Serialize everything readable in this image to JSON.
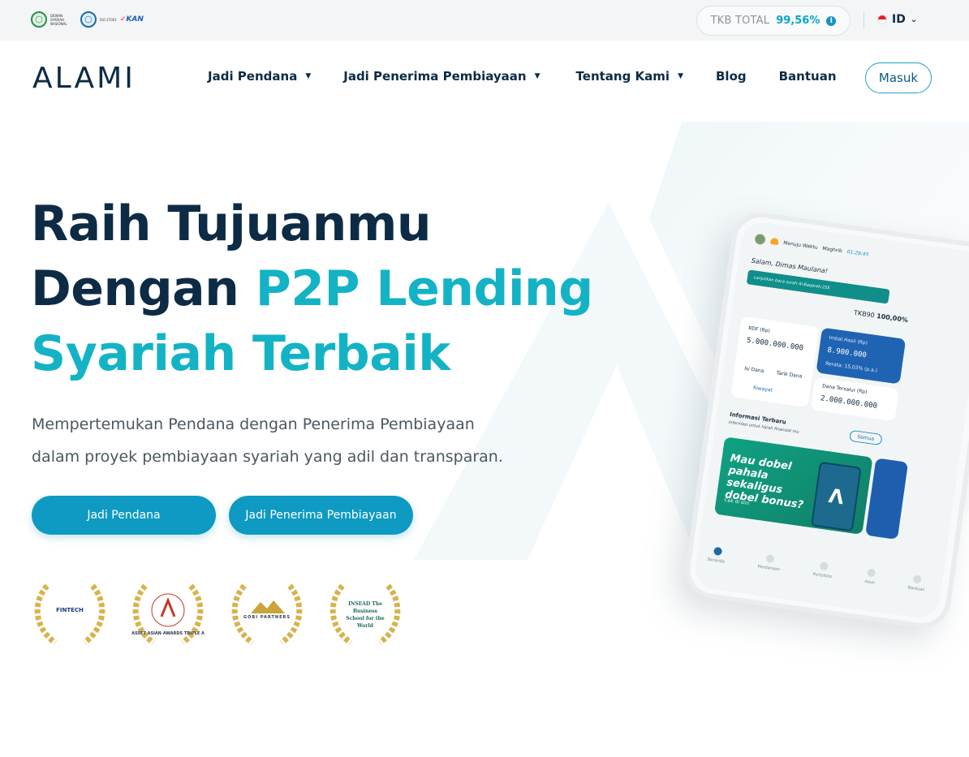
{
  "topbar": {
    "cert_mui_text": "DEWAN SYARIAH NASIONAL",
    "cert_kan_text": "ISO 27001",
    "kan_logo": "KAN",
    "tkb_label": "TKB TOTAL",
    "tkb_value": "99,56%",
    "language": "ID"
  },
  "nav": {
    "logo": "ALAMI",
    "items": [
      {
        "label": "Jadi Pendana",
        "has_dropdown": true
      },
      {
        "label": "Jadi Penerima Pembiayaan",
        "has_dropdown": true
      },
      {
        "label": "Tentang Kami",
        "has_dropdown": true
      },
      {
        "label": "Blog",
        "has_dropdown": false
      },
      {
        "label": "Bantuan",
        "has_dropdown": false
      }
    ],
    "login_label": "Masuk"
  },
  "hero": {
    "line1": "Raih Tujuanmu",
    "line2_plain": "Dengan ",
    "line2_accent": "P2P Lending",
    "line3_accent": "Syariah Terbaik",
    "subtext_line1": "Mempertemukan Pendana dengan Penerima Pembiayaan",
    "subtext_line2": "dalam proyek pembiayaan syariah yang adil dan transparan.",
    "cta_primary": "Jadi Pendana",
    "cta_secondary": "Jadi Penerima Pembiayaan"
  },
  "awards": [
    {
      "label": "FINTECH"
    },
    {
      "label": "ASSET ASIAN AWARDS TRIPLE A"
    },
    {
      "label": "GOBI PARTNERS"
    },
    {
      "label": "INSEAD The Business School for the World"
    }
  ],
  "phone": {
    "prayer_label": "Menuju Waktu",
    "prayer_name": "Maghrib",
    "prayer_time": "01:29:45",
    "greeting": "Salam, Dimas Maulana!",
    "banner": "Lanjutkan baca surah Al-Baqarah:255",
    "tkb": "TKB90",
    "tkb_value": "100,00%",
    "rdf_label": "RDF (Rp)",
    "rdf_value": "5.000.000.000",
    "isi_dana": "Isi Dana",
    "tarik_dana": "Tarik Dana",
    "riwayat": "Riwayat",
    "imbal_label": "Imbal Hasil (Rp)",
    "imbal_value": "8.900.000",
    "imbal_rate": "Rerata: 15,03% (p.a.)",
    "dana_label": "Dana Tersalur (Rp)",
    "dana_value": "2.000.000.000",
    "info_title": "Informasi Terbaru",
    "info_sub": "Informasi untuk hijrah finansial mu",
    "semua": "Semua",
    "promo_title": "Mau dobel pahala sekaligus dobel bonus?",
    "promo_link": "Cek di sini",
    "tabs": [
      "Beranda",
      "Pendanaan",
      "Portofolio",
      "Akun",
      "Bantuan"
    ]
  },
  "colors": {
    "navy": "#0d2b45",
    "accent": "#13b3c5",
    "button": "#0e9ac2"
  }
}
